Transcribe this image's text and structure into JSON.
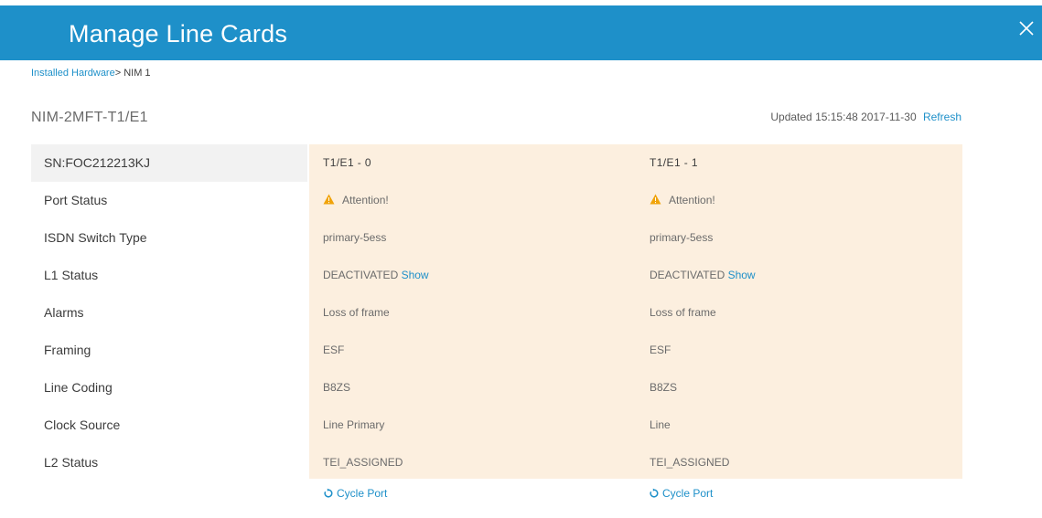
{
  "header": {
    "title": "Manage Line Cards",
    "close_icon": "close-icon"
  },
  "breadcrumb": {
    "link": "Installed Hardware",
    "separator": ">",
    "current": " NIM 1"
  },
  "card": {
    "name": "NIM-2MFT-T1/E1",
    "updated_prefix": "Updated",
    "updated_time": "15:15:48 2017-11-30",
    "refresh_label": "Refresh"
  },
  "labels": {
    "serial": "SN:FOC212213KJ",
    "port_status": "Port Status",
    "isdn_switch_type": "ISDN Switch Type",
    "l1_status": "L1 Status",
    "alarms": "Alarms",
    "framing": "Framing",
    "line_coding": "Line Coding",
    "clock_source": "Clock Source",
    "l2_status": "L2 Status"
  },
  "ports": [
    {
      "name": "T1/E1 - 0",
      "port_status": "Attention!",
      "isdn_switch_type": "primary-5ess",
      "l1_status": "DEACTIVATED",
      "l1_show": "Show",
      "alarms": "Loss of frame",
      "framing": "ESF",
      "line_coding": "B8ZS",
      "clock_source": "Line Primary",
      "l2_status": "TEI_ASSIGNED",
      "cycle_label": "Cycle Port"
    },
    {
      "name": "T1/E1 - 1",
      "port_status": "Attention!",
      "isdn_switch_type": "primary-5ess",
      "l1_status": "DEACTIVATED",
      "l1_show": "Show",
      "alarms": "Loss of frame",
      "framing": "ESF",
      "line_coding": "B8ZS",
      "clock_source": "Line",
      "l2_status": "TEI_ASSIGNED",
      "cycle_label": "Cycle Port"
    }
  ],
  "colors": {
    "header": "#1e90c9",
    "link": "#1e90c9",
    "panel": "#fcefdf",
    "warning": "#f0a30a"
  },
  "icons": {
    "warning": "warning-triangle-icon",
    "cycle": "cycle-icon"
  }
}
